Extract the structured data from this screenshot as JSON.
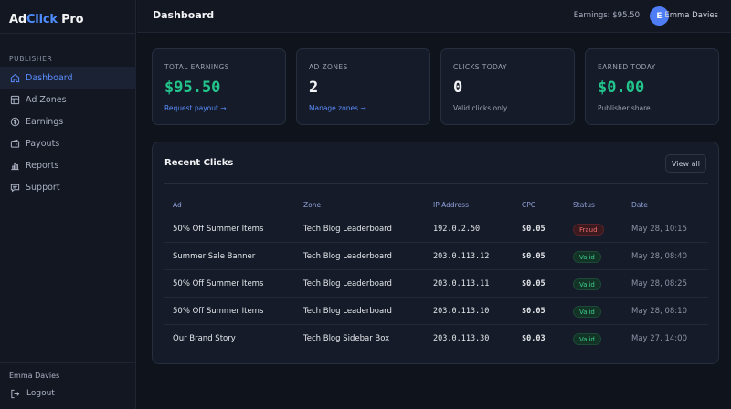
{
  "sidebar": {
    "logo_main": "Ad",
    "logo_accent": "Click",
    "logo_suffix": " Pro",
    "section_label": "PUBLISHER",
    "items": [
      {
        "label": "Dashboard",
        "icon": "home-icon"
      },
      {
        "label": "Ad Zones",
        "icon": "layout-icon"
      },
      {
        "label": "Earnings",
        "icon": "dollar-icon"
      },
      {
        "label": "Payouts",
        "icon": "wallet-icon"
      },
      {
        "label": "Reports",
        "icon": "bar-chart-icon"
      },
      {
        "label": "Support",
        "icon": "chat-icon"
      }
    ],
    "user_name": "Emma Davies",
    "logout_label": "Logout"
  },
  "header": {
    "title": "Dashboard",
    "earnings_text": "Earnings: $95.50",
    "avatar_initial": "E",
    "user_name": "Emma Davies"
  },
  "cards": [
    {
      "label": "TOTAL EARNINGS",
      "value": "$95.50",
      "sub": "Request payout →"
    },
    {
      "label": "AD ZONES",
      "value": "2",
      "sub": "Manage zones →"
    },
    {
      "label": "CLICKS TODAY",
      "value": "0",
      "sub": "Valid clicks only"
    },
    {
      "label": "EARNED TODAY",
      "value": "$0.00",
      "sub": "Publisher share"
    }
  ],
  "recent": {
    "title": "Recent Clicks",
    "view_all": "View all",
    "columns": [
      "Ad",
      "Zone",
      "IP Address",
      "CPC",
      "Status",
      "Date"
    ],
    "rows": [
      {
        "ad": "50% Off Summer Items",
        "zone": "Tech Blog Leaderboard",
        "ip": "192.0.2.50",
        "cpc": "$0.05",
        "status": "Fraud",
        "date": "May 28, 10:15"
      },
      {
        "ad": "Summer Sale Banner",
        "zone": "Tech Blog Leaderboard",
        "ip": "203.0.113.12",
        "cpc": "$0.05",
        "status": "Valid",
        "date": "May 28, 08:40"
      },
      {
        "ad": "50% Off Summer Items",
        "zone": "Tech Blog Leaderboard",
        "ip": "203.0.113.11",
        "cpc": "$0.05",
        "status": "Valid",
        "date": "May 28, 08:25"
      },
      {
        "ad": "50% Off Summer Items",
        "zone": "Tech Blog Leaderboard",
        "ip": "203.0.113.10",
        "cpc": "$0.05",
        "status": "Valid",
        "date": "May 28, 08:10"
      },
      {
        "ad": "Our Brand Story",
        "zone": "Tech Blog Sidebar Box",
        "ip": "203.0.113.30",
        "cpc": "$0.03",
        "status": "Valid",
        "date": "May 27, 14:00"
      }
    ]
  },
  "colors": {
    "accent": "#4f8cff",
    "green": "#22c58b",
    "fraud": "#f26d6d"
  }
}
